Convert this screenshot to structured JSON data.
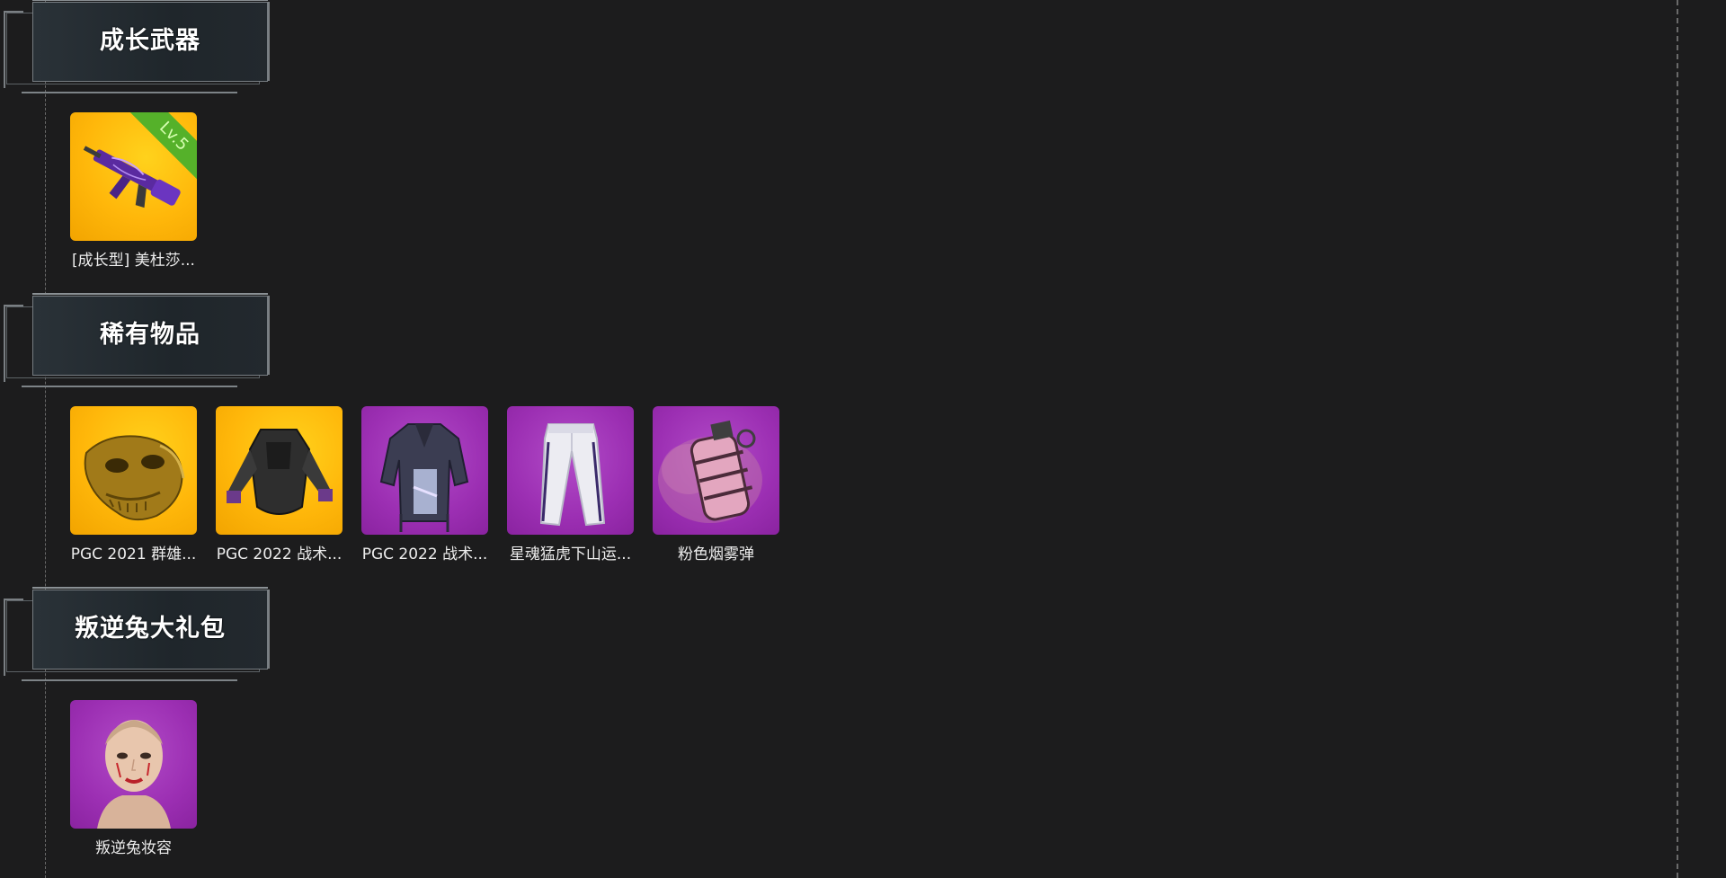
{
  "sections": [
    {
      "title": "成长武器",
      "items": [
        {
          "label": "[成长型] 美杜莎...",
          "rarity": "gold",
          "badge": "Lv.5",
          "icon": "rifle-icon"
        }
      ]
    },
    {
      "title": "稀有物品",
      "items": [
        {
          "label": "PGC 2021 群雄...",
          "rarity": "gold",
          "icon": "mask-icon"
        },
        {
          "label": "PGC 2022 战术...",
          "rarity": "gold",
          "icon": "vest-icon"
        },
        {
          "label": "PGC 2022 战术...",
          "rarity": "purple",
          "icon": "jacket-icon"
        },
        {
          "label": "星魂猛虎下山运...",
          "rarity": "purple",
          "icon": "pants-icon"
        },
        {
          "label": "粉色烟雾弹",
          "rarity": "purple",
          "icon": "smoke-grenade-icon"
        }
      ]
    },
    {
      "title": "叛逆兔大礼包",
      "items": [
        {
          "label": "叛逆兔妆容",
          "rarity": "purple",
          "icon": "face-makeup-icon"
        }
      ]
    }
  ],
  "colors": {
    "background": "#1c1c1d",
    "gold": "#ffb70a",
    "purple": "#9c2fb3",
    "badge_green": "#55b12a"
  }
}
